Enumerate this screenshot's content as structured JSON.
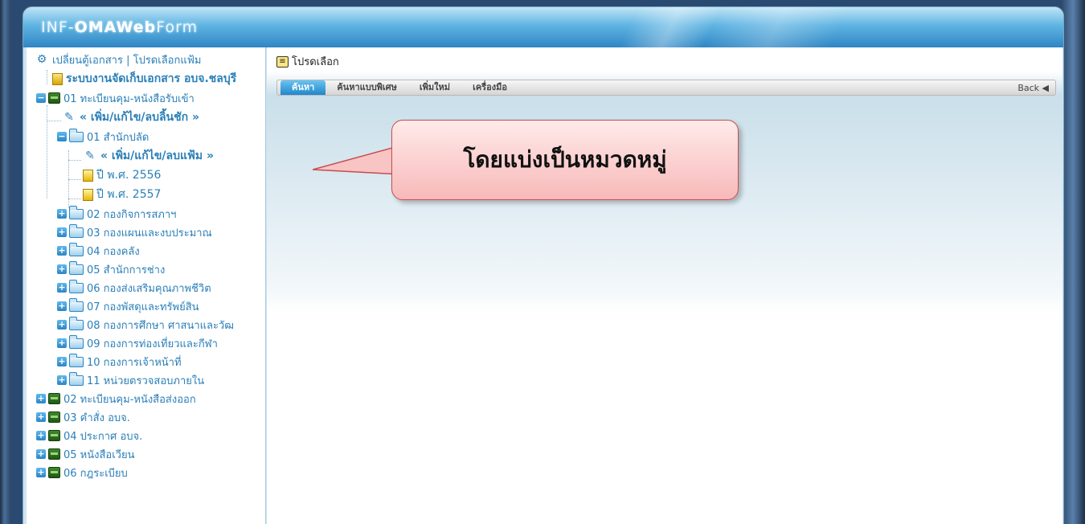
{
  "app": {
    "logo_part1": "INF-",
    "logo_part2": "OMAWeb",
    "logo_part3": "Form"
  },
  "sidebar": {
    "top_link": "เปลี่ยนตู้เอกสาร | โปรดเลือกแฟ้ม",
    "root": "ระบบงานจัดเก็บเอกสาร อบจ.ชลบุรี",
    "items": [
      {
        "label": "01 ทะเบียนคุม-หนังสือรับเข้า",
        "expander": "−",
        "icon": "green-cabinet-icon"
      },
      {
        "label": "« เพิ่ม/แก้ไข/ลบลิ้นชัก »",
        "icon": "edit-cabinet-icon"
      },
      {
        "label": "01 สำนักปลัด",
        "expander": "−",
        "icon": "folder-icon"
      },
      {
        "label": "« เพิ่ม/แก้ไข/ลบแฟ้ม »",
        "icon": "edit-folder-icon"
      },
      {
        "label": "ปี พ.ศ. 2556",
        "icon": "yellow-file-icon"
      },
      {
        "label": "ปี พ.ศ. 2557",
        "icon": "yellow-file-icon"
      },
      {
        "label": "02 กองกิจการสภาฯ",
        "expander": "+"
      },
      {
        "label": "03 กองแผนและงบประมาณ",
        "expander": "+"
      },
      {
        "label": "04 กองคลัง",
        "expander": "+"
      },
      {
        "label": "05 สำนักการช่าง",
        "expander": "+"
      },
      {
        "label": "06 กองส่งเสริมคุณภาพชีวิต",
        "expander": "+"
      },
      {
        "label": "07 กองพัสดุและทรัพย์สิน",
        "expander": "+"
      },
      {
        "label": "08 กองการศึกษา ศาสนาและวัฒ",
        "expander": "+"
      },
      {
        "label": "09 กองการท่องเที่ยวและกีฬา",
        "expander": "+"
      },
      {
        "label": "10 กองการเจ้าหน้าที่",
        "expander": "+"
      },
      {
        "label": "11 หน่วยตรวจสอบภายใน",
        "expander": "+"
      },
      {
        "label": "02 ทะเบียนคุม-หนังสือส่งออก",
        "expander": "+"
      },
      {
        "label": "03 คำสั่ง อบจ.",
        "expander": "+"
      },
      {
        "label": "04 ประกาศ อบจ.",
        "expander": "+"
      },
      {
        "label": "05 หนังสือเวียน",
        "expander": "+"
      },
      {
        "label": "06 กฎระเบียบ",
        "expander": "+"
      }
    ]
  },
  "main": {
    "title": "โปรดเลือก",
    "tabs": [
      {
        "label": "ค้นหา",
        "active": true
      },
      {
        "label": "ค้นหาแบบพิเศษ"
      },
      {
        "label": "เพิ่มใหม่"
      },
      {
        "label": "เครื่องมือ"
      }
    ],
    "back_label": "Back ◀"
  },
  "callout": {
    "text": "โดยแบ่งเป็นหมวดหมู่"
  },
  "colors": {
    "link": "#2a7fb8",
    "accent": "#1f86cb",
    "callout_fill": "#f8b9b9",
    "callout_border": "#c64d4d"
  }
}
